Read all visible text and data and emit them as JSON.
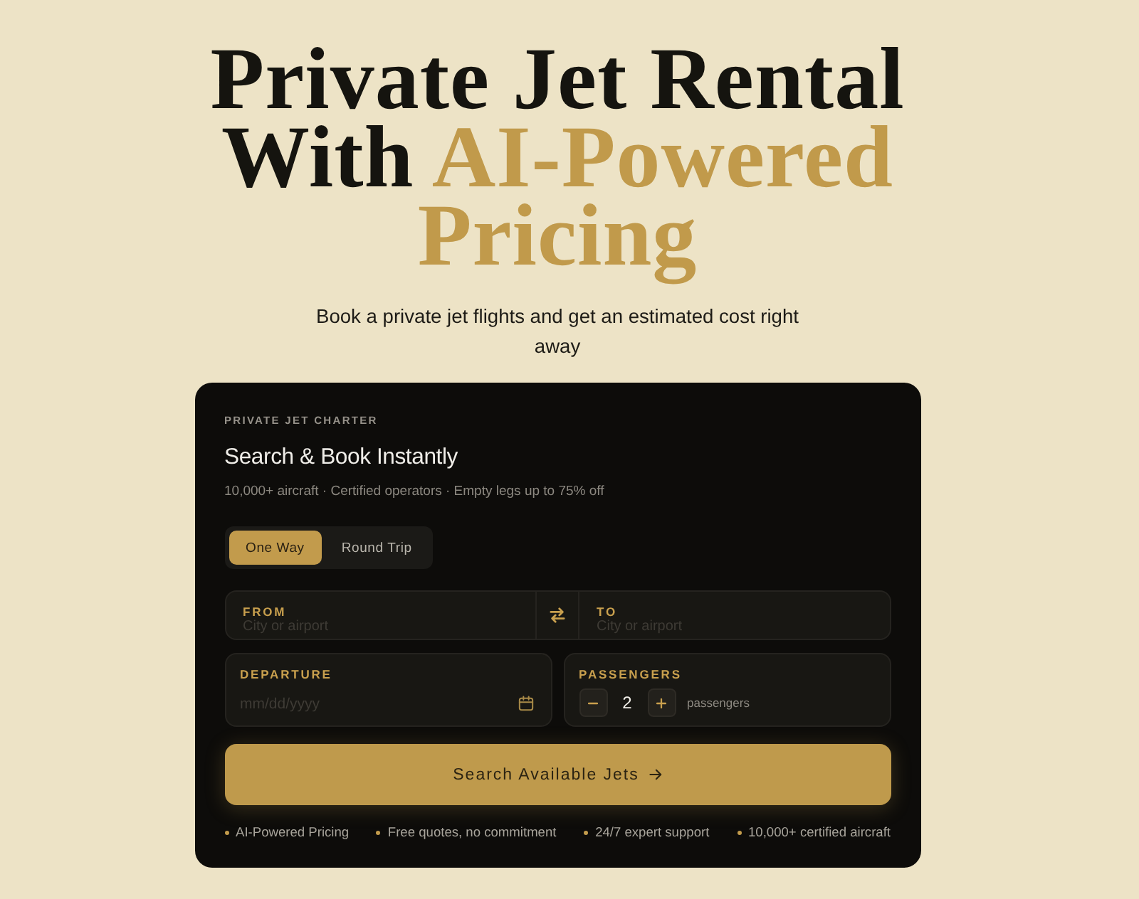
{
  "hero": {
    "headline": {
      "lead": "Private Jet Rental With",
      "highlight": "AI-Powered Pricing"
    },
    "subtitle": "Book a private jet flights and get an estimated cost right away"
  },
  "card": {
    "eyebrow": "PRIVATE JET CHARTER",
    "title": "Search & Book Instantly",
    "tagline": "10,000+ aircraft · Certified operators · Empty legs up to 75% off",
    "trip_types": [
      {
        "label": "One Way",
        "selected": true
      },
      {
        "label": "Round Trip",
        "selected": false
      }
    ],
    "route": {
      "from": {
        "label": "FROM",
        "placeholder": "City or airport"
      },
      "to": {
        "label": "TO",
        "placeholder": "City or airport"
      }
    },
    "departure": {
      "label": "DEPARTURE",
      "placeholder": "mm/dd/yyyy"
    },
    "passengers": {
      "label": "PASSENGERS",
      "value": "2",
      "unit": "passengers"
    },
    "search_button": "Search Available Jets",
    "features": [
      "AI-Powered Pricing",
      "Free quotes, no commitment",
      "24/7 expert support",
      "10,000+ certified aircraft"
    ]
  }
}
